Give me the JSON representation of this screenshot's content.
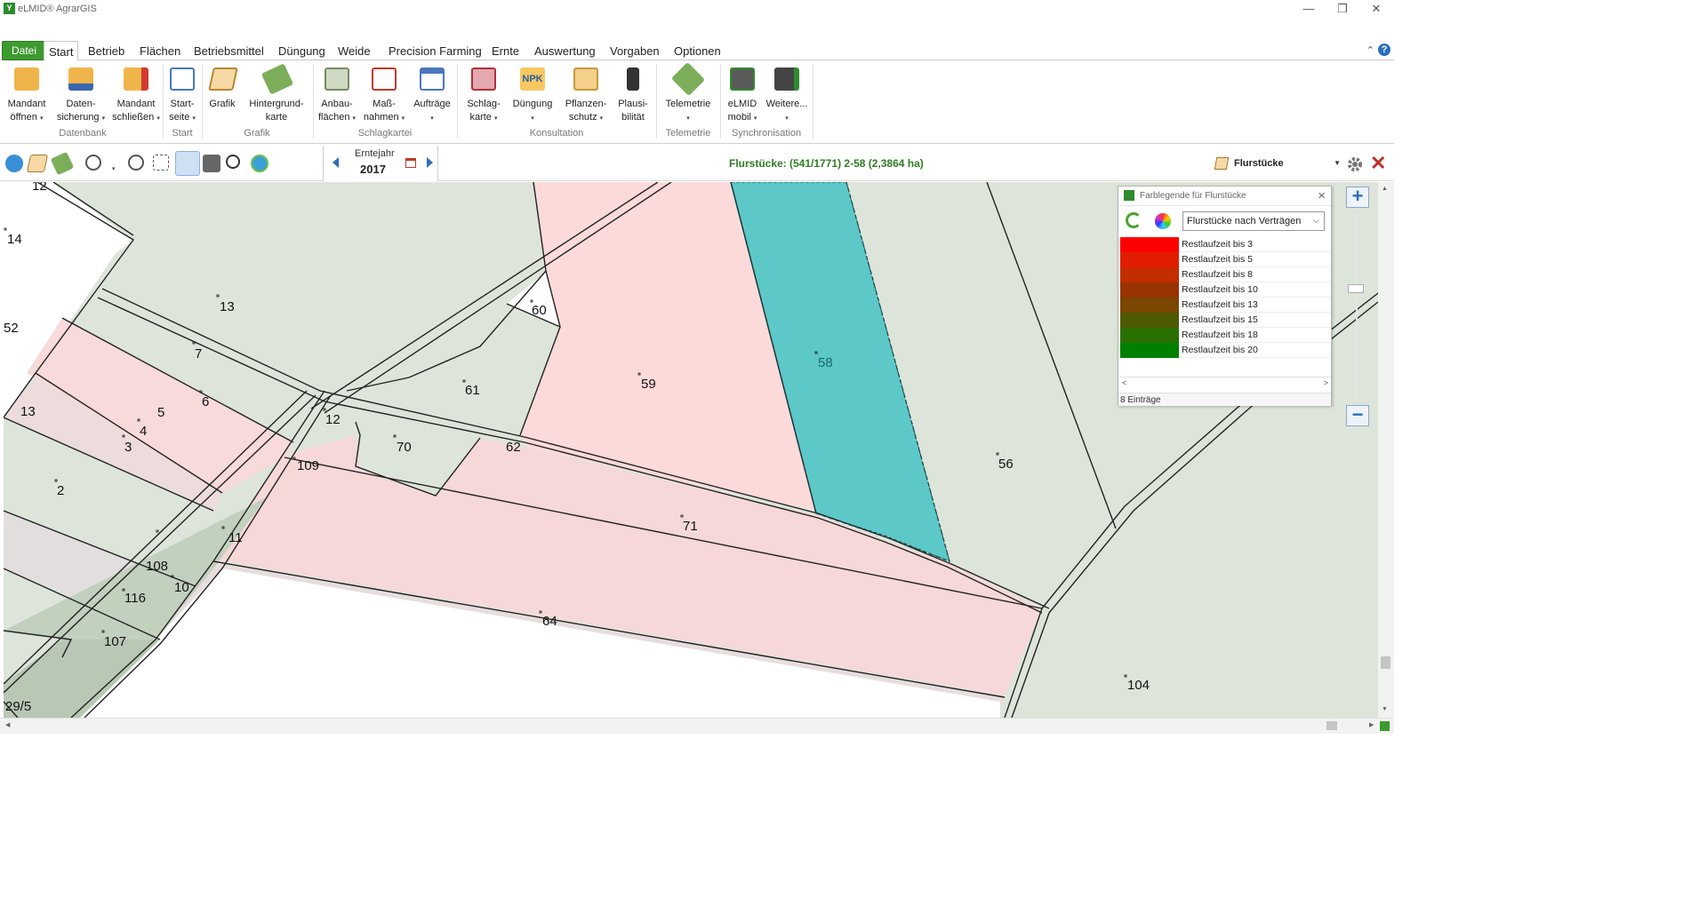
{
  "window": {
    "title": "eLMID® AgrarGIS",
    "minimize": "—",
    "maximize": "❐",
    "close": "✕"
  },
  "menu": {
    "file": "Datei",
    "tabs": [
      "Start",
      "Betrieb",
      "Flächen",
      "Betriebsmittel",
      "Düngung",
      "Weide",
      "Precision Farming",
      "Ernte",
      "Auswertung",
      "Vorgaben",
      "Optionen"
    ],
    "active": "Start",
    "collapse": "⌃",
    "help": "?"
  },
  "ribbon": {
    "buttons": [
      {
        "l1": "Mandant",
        "l2": "öffnen",
        "dd": true,
        "icon": "folder-open-icon"
      },
      {
        "l1": "Daten-",
        "l2": "sicherung",
        "dd": true,
        "icon": "backup-icon"
      },
      {
        "l1": "Mandant",
        "l2": "schließen",
        "dd": true,
        "icon": "folder-close-icon"
      },
      {
        "l1": "Start-",
        "l2": "seite",
        "dd": true,
        "icon": "dashboard-icon"
      },
      {
        "l1": "Grafik",
        "l2": "",
        "dd": false,
        "icon": "graphic-icon"
      },
      {
        "l1": "Hintergrund-",
        "l2": "karte",
        "dd": false,
        "icon": "background-map-icon"
      },
      {
        "l1": "Anbau-",
        "l2": "flächen",
        "dd": true,
        "icon": "crop-area-icon"
      },
      {
        "l1": "Maß-",
        "l2": "nahmen",
        "dd": true,
        "icon": "tractor-icon"
      },
      {
        "l1": "Aufträge",
        "l2": "",
        "dd": true,
        "icon": "calendar-icon"
      },
      {
        "l1": "Schlag-",
        "l2": "karte",
        "dd": true,
        "icon": "field-card-icon"
      },
      {
        "l1": "Düngung",
        "l2": "",
        "dd": true,
        "icon": "npk-icon",
        "npk": "NPK"
      },
      {
        "l1": "Pflanzen-",
        "l2": "schutz",
        "dd": true,
        "icon": "plant-protection-icon"
      },
      {
        "l1": "Plausi-",
        "l2": "bilität",
        "dd": false,
        "icon": "traffic-light-icon"
      },
      {
        "l1": "Telemetrie",
        "l2": "",
        "dd": true,
        "icon": "telemetry-icon"
      },
      {
        "l1": "eLMID",
        "l2": "mobil",
        "dd": true,
        "icon": "mobile-sync-icon"
      },
      {
        "l1": "Weitere...",
        "l2": "",
        "dd": true,
        "icon": "more-devices-icon"
      }
    ],
    "groups": [
      "Datenbank",
      "Start",
      "Grafik",
      "Schlagkartei",
      "Konsultation",
      "Telemetrie",
      "Synchronisation"
    ]
  },
  "toolbar": {
    "harvest_year_label": "Erntejahr",
    "harvest_year": "2017",
    "status": "Flurstücke: (541/1771) 2-58 (2,3864 ha)",
    "layer": "Flurstücke"
  },
  "map": {
    "labels": [
      "12",
      "14",
      "13",
      "52",
      "7",
      "6",
      "5",
      "4",
      "3",
      "13",
      "2",
      "60",
      "59",
      "61",
      "12",
      "70",
      "62",
      "109",
      "58",
      "56",
      "71",
      "11",
      "108",
      "10",
      "116",
      "107",
      "64",
      "104",
      "29/5"
    ]
  },
  "legend": {
    "title": "Farblegende für Flurstücke",
    "dropdown": "Flurstücke nach Verträgen",
    "items": [
      {
        "label": "Restlaufzeit bis 3",
        "color": "#ff0000"
      },
      {
        "label": "Restlaufzeit bis 5",
        "color": "#e11c00"
      },
      {
        "label": "Restlaufzeit bis 8",
        "color": "#c42d00"
      },
      {
        "label": "Restlaufzeit bis 10",
        "color": "#993300"
      },
      {
        "label": "Restlaufzeit bis 13",
        "color": "#7a4600"
      },
      {
        "label": "Restlaufzeit bis 15",
        "color": "#4e5a00"
      },
      {
        "label": "Restlaufzeit bis 18",
        "color": "#2a7000"
      },
      {
        "label": "Restlaufzeit bis 20",
        "color": "#008000"
      }
    ],
    "count": "8 Einträge"
  }
}
